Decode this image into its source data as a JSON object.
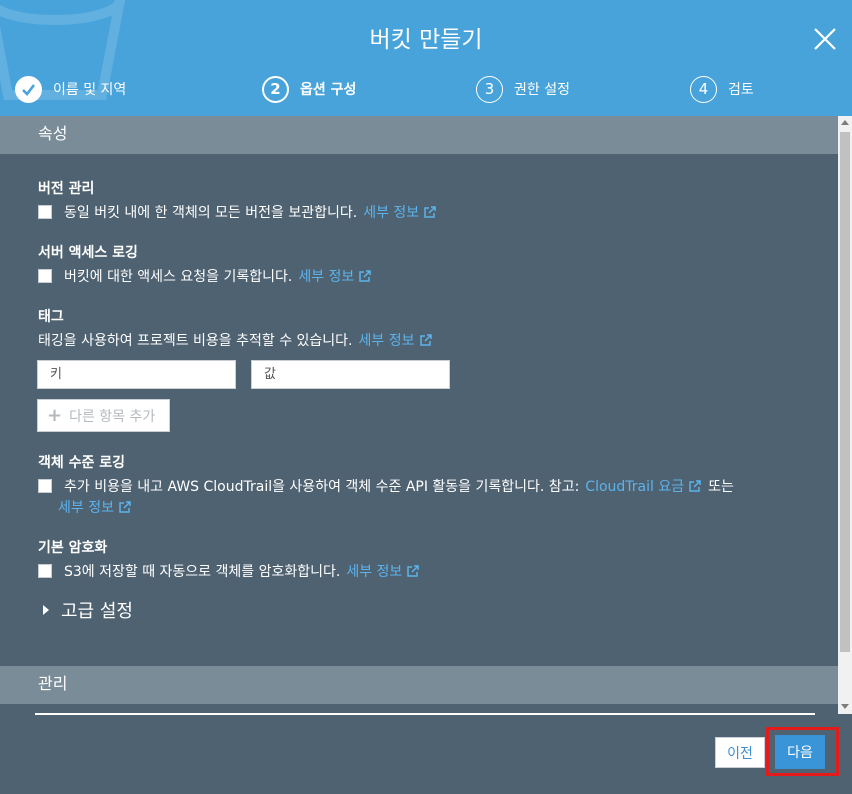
{
  "header": {
    "title": "버킷 만들기",
    "steps": [
      {
        "num": "✓",
        "label": "이름 및 지역",
        "state": "done"
      },
      {
        "num": "2",
        "label": "옵션 구성",
        "state": "active"
      },
      {
        "num": "3",
        "label": "권한 설정",
        "state": "pending"
      },
      {
        "num": "4",
        "label": "검토",
        "state": "pending"
      }
    ]
  },
  "sections": {
    "properties_title": "속성",
    "management_title": "관리"
  },
  "versioning": {
    "title": "버전 관리",
    "text": "동일 버킷 내에 한 객체의 모든 버전을 보관합니다.",
    "link": "세부 정보"
  },
  "access_logging": {
    "title": "서버 액세스 로깅",
    "text": "버킷에 대한 액세스 요청을 기록합니다.",
    "link": "세부 정보"
  },
  "tags": {
    "title": "태그",
    "text": "태깅을 사용하여 프로젝트 비용을 추적할 수 있습니다.",
    "link": "세부 정보",
    "key_placeholder": "키",
    "value_placeholder": "값",
    "add_label": "다른 항목 추가"
  },
  "object_logging": {
    "title": "객체 수준 로깅",
    "text": "추가 비용을 내고 AWS CloudTrail을 사용하여 객체 수준 API 활동을 기록합니다. 참고:",
    "pricing_link": "CloudTrail 요금",
    "or": "또는",
    "link": "세부 정보"
  },
  "encryption": {
    "title": "기본 암호화",
    "text": "S3에 저장할 때 자동으로 객체를 암호화합니다.",
    "link": "세부 정보"
  },
  "advanced": {
    "label": "고급 설정"
  },
  "footer": {
    "prev_label": "이전",
    "next_label": "다음"
  },
  "colors": {
    "header": "#47a3da",
    "body": "#4f6271",
    "section_bar": "#7a8c98",
    "link": "#5cb3ec",
    "primary": "#3a95d8",
    "highlight": "#e51b1b"
  }
}
